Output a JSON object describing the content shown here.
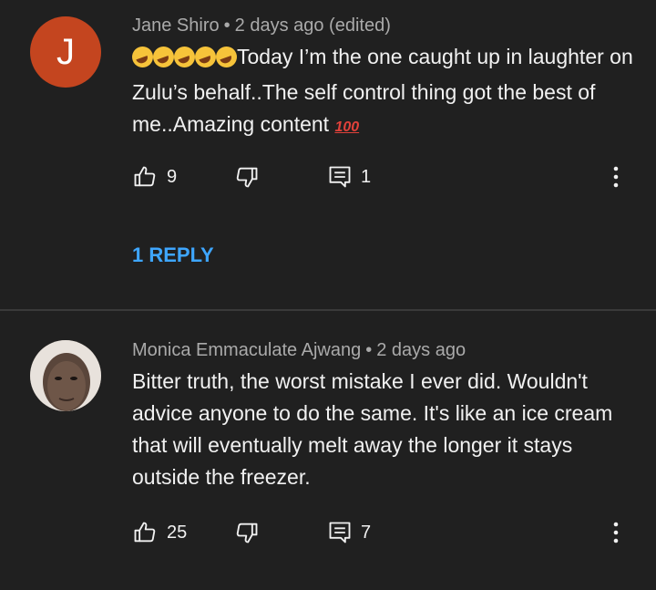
{
  "comments": [
    {
      "avatar_letter": "J",
      "avatar_color": "#c4451f",
      "author": "Jane Shiro",
      "separator": "•",
      "time": "2 days ago (edited)",
      "text": "Today I’m the one caught up in laughter on Zulu’s behalf..The self control thing got the best of me..Amazing content",
      "emoji_prefix": "rolling-on-floor-laughing x5",
      "emoji_suffix": "hundred-points",
      "likes": "9",
      "replies_count": "1",
      "reply_link": "1 REPLY"
    },
    {
      "author": "Monica Emmaculate Ajwang",
      "separator": "•",
      "time": "2 days ago",
      "text": "Bitter truth, the worst mistake I ever did. Wouldn't advice anyone to do the same. It's like an ice cream that will eventually melt away the longer it stays outside the freezer.",
      "likes": "25",
      "replies_count": "7"
    }
  ],
  "colors": {
    "background": "#202020",
    "meta_text": "#aaaaaa",
    "body_text": "#f1f1f1",
    "link": "#3ea6ff"
  },
  "icons": {
    "like": "thumbs-up-icon",
    "dislike": "thumbs-down-icon",
    "reply": "comment-icon",
    "more": "more-vert-icon"
  }
}
